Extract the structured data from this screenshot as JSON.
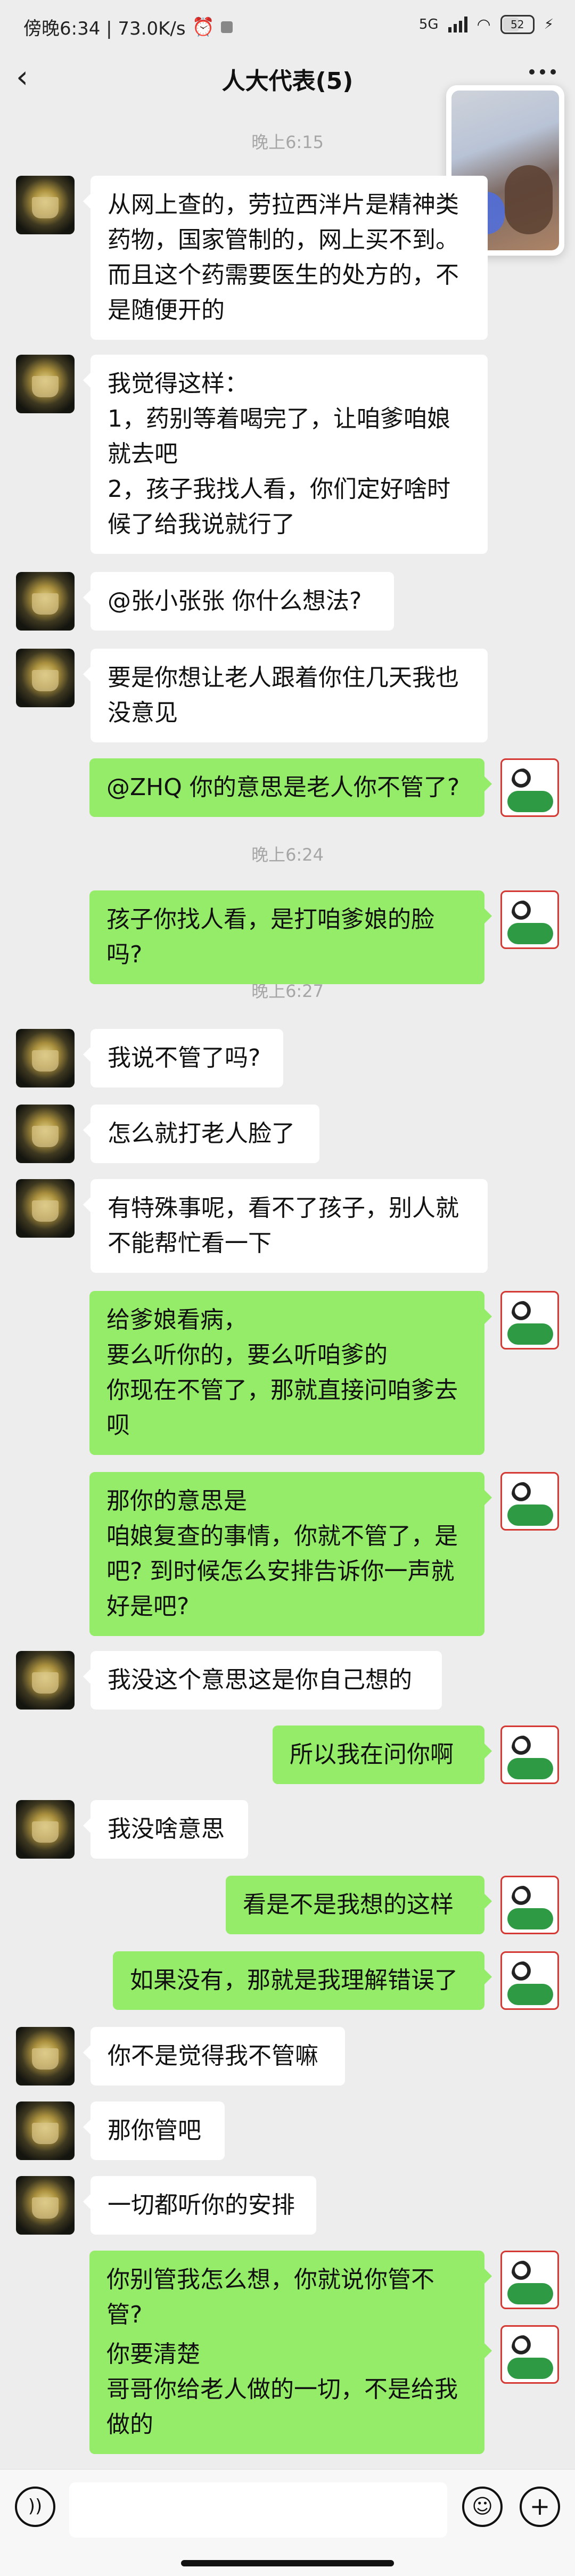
{
  "status_bar": {
    "time_speed": "傍晚6:34 | 73.0K/s",
    "network": "5G",
    "battery": "52"
  },
  "header": {
    "title": "人大代表(5)",
    "back_icon": "chevron-left-icon",
    "more_icon": "more-dots-icon"
  },
  "timestamps": [
    "晚上6:15",
    "晚上6:24",
    "晚上6:27"
  ],
  "messages": [
    {
      "side": "left",
      "text": "从网上查的，劳拉西泮片是精神类药物，国家管制的，网上买不到。而且这个药需要医生的处方的，不是随便开的"
    },
    {
      "side": "left",
      "text": "我觉得这样：\n1，药别等着喝完了，让咱爹咱娘就去吧\n2，孩子我找人看，你们定好啥时候了给我说就行了"
    },
    {
      "side": "left",
      "text": "@张小张张  你什么想法?"
    },
    {
      "side": "left",
      "text": "要是你想让老人跟着你住几天我也没意见"
    },
    {
      "side": "right",
      "text": "@ZHQ  你的意思是老人你不管了?"
    },
    {
      "side": "right",
      "text": "孩子你找人看，是打咱爹娘的脸吗?"
    },
    {
      "side": "left",
      "text": "我说不管了吗?"
    },
    {
      "side": "left",
      "text": "怎么就打老人脸了"
    },
    {
      "side": "left",
      "text": "有特殊事呢，看不了孩子，别人就不能帮忙看一下"
    },
    {
      "side": "right",
      "text": "给爹娘看病，\n要么听你的，要么听咱爹的\n你现在不管了，那就直接问咱爹去呗"
    },
    {
      "side": "right",
      "text": "那你的意思是\n咱娘复查的事情，你就不管了，是吧? 到时候怎么安排告诉你一声就好是吧?"
    },
    {
      "side": "left",
      "text": "我没这个意思这是你自己想的"
    },
    {
      "side": "right",
      "text": "所以我在问你啊"
    },
    {
      "side": "left",
      "text": "我没啥意思"
    },
    {
      "side": "right",
      "text": "看是不是我想的这样"
    },
    {
      "side": "right",
      "text": "如果没有，那就是我理解错误了"
    },
    {
      "side": "left",
      "text": "你不是觉得我不管嘛"
    },
    {
      "side": "left",
      "text": "那你管吧"
    },
    {
      "side": "left",
      "text": "一切都听你的安排"
    },
    {
      "side": "right",
      "text": "你别管我怎么想，你就说你管不管?"
    },
    {
      "side": "right",
      "text": "你要清楚\n哥哥你给老人做的一切，不是给我做的"
    }
  ],
  "input_bar": {
    "voice_icon": "voice-icon",
    "emoji_icon": "emoji-icon",
    "plus_icon": "plus-icon"
  }
}
